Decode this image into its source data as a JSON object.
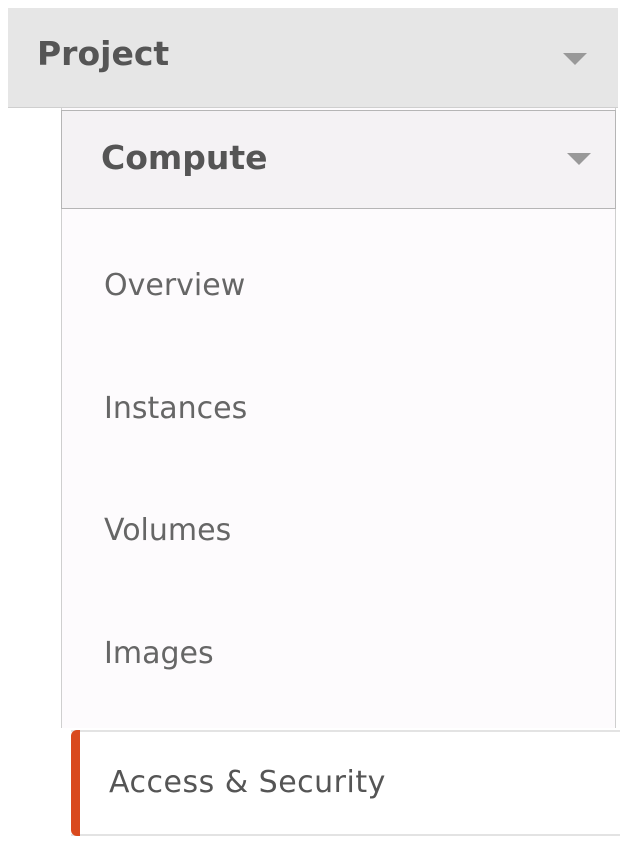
{
  "project": {
    "label": "Project",
    "icon": "chevron-down-icon"
  },
  "compute": {
    "label": "Compute",
    "icon": "chevron-down-icon"
  },
  "items": [
    {
      "label": "Overview"
    },
    {
      "label": "Instances"
    },
    {
      "label": "Volumes"
    },
    {
      "label": "Images"
    }
  ],
  "active_item": {
    "label": "Access & Security",
    "accent_color": "#d94a1e"
  }
}
